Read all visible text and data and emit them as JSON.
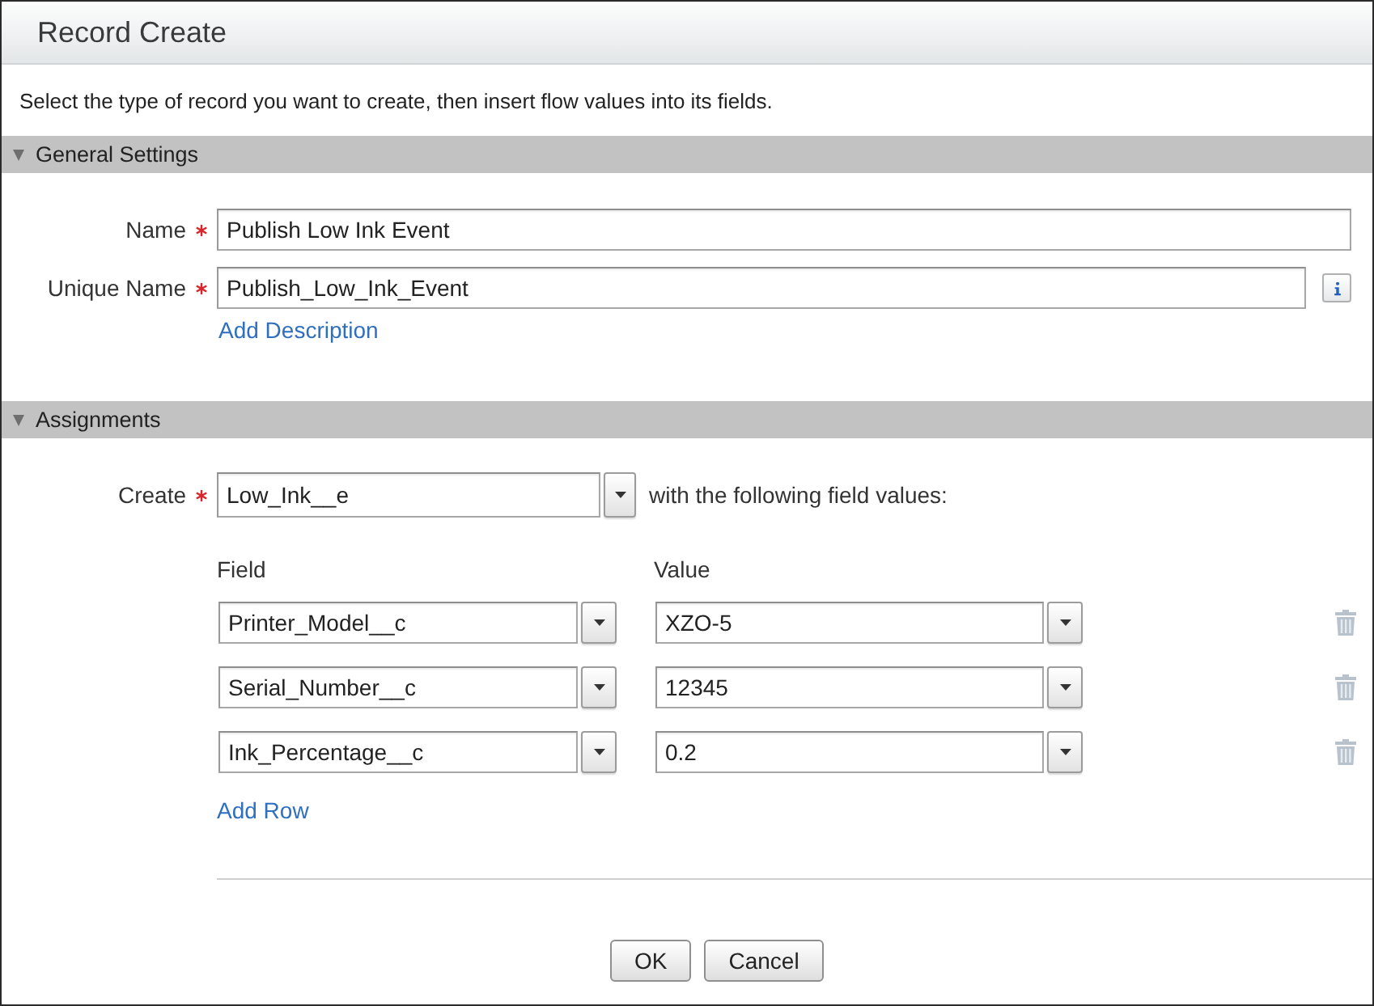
{
  "window": {
    "title": "Record Create"
  },
  "description": "Select the type of record you want to create, then insert flow values into its fields.",
  "general_settings": {
    "title": "General Settings",
    "expanded": true,
    "fields": [
      {
        "label": "Name",
        "required": true,
        "value": "Publish Low Ink Event",
        "info_button": false
      },
      {
        "label": "Unique Name",
        "required": true,
        "value": "Publish_Low_Ink_Event",
        "info_button": true
      }
    ],
    "link": "Add Description"
  },
  "assignments": {
    "title": "Assignments",
    "expanded": true,
    "create": {
      "label": "Create",
      "required": true,
      "value": "Low_Ink__e",
      "note": "with the following field values:"
    },
    "columns": [
      "Field",
      "Value"
    ],
    "rows": [
      {
        "field": "Printer_Model__c",
        "value": "XZO-5"
      },
      {
        "field": "Serial_Number__c",
        "value": "12345"
      },
      {
        "field": "Ink_Percentage__c",
        "value": "0.2"
      }
    ],
    "link": "Add Row"
  },
  "buttons": [
    {
      "label": "OK"
    },
    {
      "label": "Cancel"
    }
  ]
}
